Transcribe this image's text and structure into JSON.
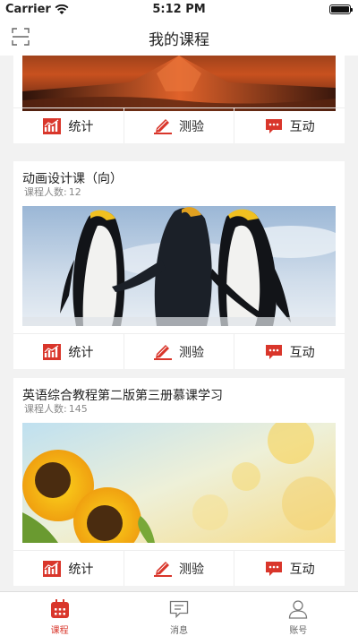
{
  "status": {
    "carrier": "Carrier",
    "time": "5:12 PM"
  },
  "nav": {
    "title": "我的课程"
  },
  "actions": {
    "stats": "统计",
    "quiz": "测验",
    "interact": "互动"
  },
  "count_label": "课程人数:",
  "courses": [
    {
      "title": "",
      "count": "",
      "image": "volcano-landscape"
    },
    {
      "title": "动画设计课（向）",
      "count": "12",
      "image": "penguins"
    },
    {
      "title": "英语综合教程第二版第三册慕课学习",
      "count": "145",
      "image": "sunflowers"
    }
  ],
  "tabs": [
    {
      "label": "课程",
      "icon": "calendar-icon",
      "active": true
    },
    {
      "label": "消息",
      "icon": "message-icon",
      "active": false
    },
    {
      "label": "账号",
      "icon": "user-icon",
      "active": false
    }
  ],
  "colors": {
    "accent": "#d9362b",
    "background": "#f2f2f2"
  }
}
